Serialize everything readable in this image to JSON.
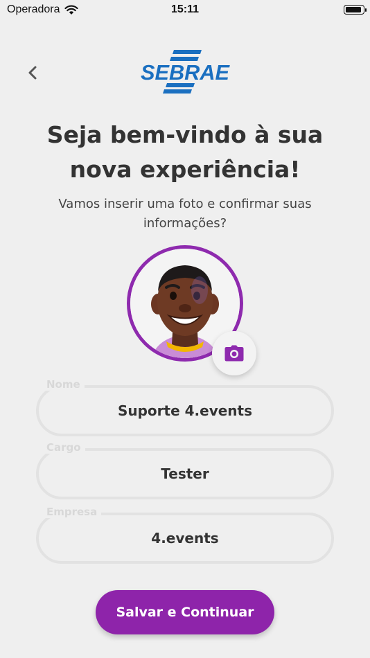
{
  "status_bar": {
    "carrier": "Operadora",
    "time": "15:11",
    "battery_level": 0.95
  },
  "header": {
    "back_icon": "chevron-left-icon",
    "logo_text": "SEBRAE",
    "logo_color": "#1a6fc0"
  },
  "welcome": {
    "title_line1": "Seja bem-vindo à sua",
    "title_line2": "nova experiência!",
    "subtitle_line1": "Vamos inserir uma foto e confirmar suas",
    "subtitle_line2": "informações?"
  },
  "profile_photo": {
    "ring_color": "#8e2aae",
    "camera_icon": "camera-icon"
  },
  "form": {
    "fields": [
      {
        "label": "Nome",
        "value": "Suporte 4.events"
      },
      {
        "label": "Cargo",
        "value": "Tester"
      },
      {
        "label": "Empresa",
        "value": "4.events"
      }
    ]
  },
  "actions": {
    "submit_label": "Salvar e Continuar",
    "accent_color": "#8e24aa"
  }
}
